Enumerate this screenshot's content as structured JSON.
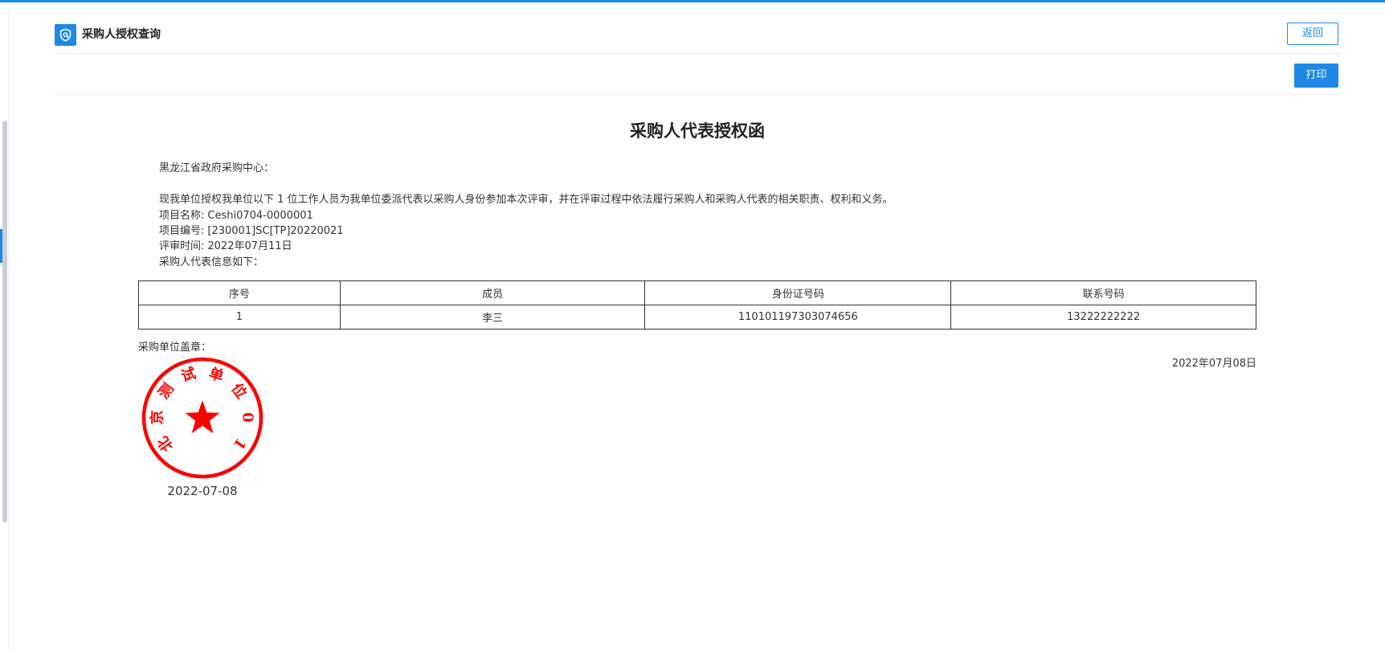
{
  "header": {
    "title": "采购人授权查询",
    "back_label": "返回",
    "print_label": "打印",
    "icon": "shield-icon"
  },
  "document": {
    "title": "采购人代表授权函",
    "addressee": "黑龙江省政府采购中心：",
    "statement": "现我单位授权我单位以下 1 位工作人员为我单位委派代表以采购人身份参加本次评审，并在评审过程中依法履行采购人和采购人代表的相关职责、权利和义务。",
    "project_name_label": "项目名称:",
    "project_name": "Ceshi0704-0000001",
    "project_no_label": "项目编号:",
    "project_no": "[230001]SC[TP]20220021",
    "review_time_label": "评审时间:",
    "review_time": "2022年07月11日",
    "rep_info_label": "采购人代表信息如下：",
    "table": {
      "headers": [
        "序号",
        "成员",
        "身份证号码",
        "联系号码"
      ],
      "rows": [
        [
          "1",
          "李三",
          "110101197303074656",
          "13222222222"
        ]
      ]
    },
    "stamp_label": "采购单位盖章：",
    "sign_date": "2022年07月08日",
    "seal": {
      "text": "北京测试单位01",
      "date": "2022-07-08",
      "color": "#ff0000"
    }
  },
  "colors": {
    "accent": "#1e88e5",
    "seal": "#ff0000"
  }
}
